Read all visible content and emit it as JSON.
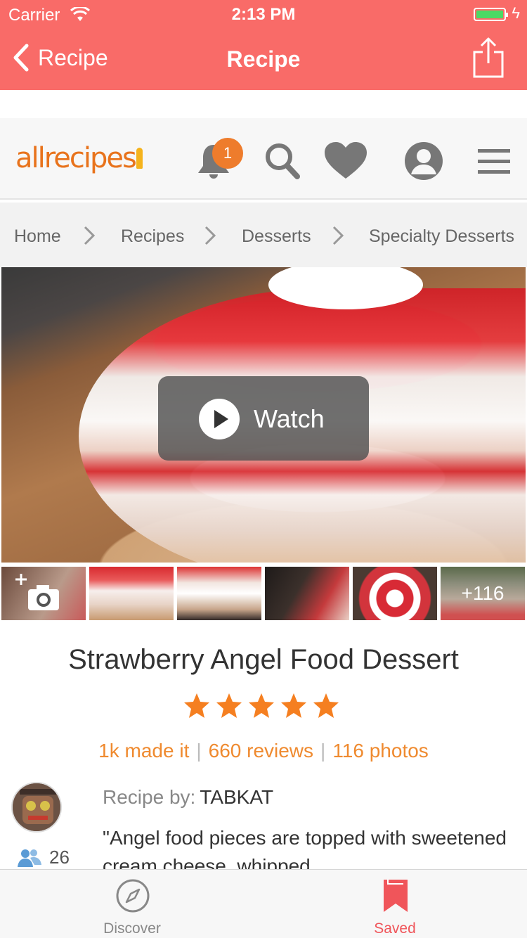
{
  "status_bar": {
    "carrier": "Carrier",
    "time": "2:13 PM"
  },
  "nav": {
    "back_label": "Recipe",
    "title": "Recipe"
  },
  "header": {
    "logo_text": "allrecipes",
    "notification_count": "1"
  },
  "breadcrumb": [
    "Home",
    "Recipes",
    "Desserts",
    "Specialty Desserts"
  ],
  "hero": {
    "watch_label": "Watch"
  },
  "thumbnails": {
    "more_label": "+116"
  },
  "recipe": {
    "title": "Strawberry Angel Food Dessert",
    "rating": 5,
    "made_it": "1k made it",
    "reviews": "660 reviews",
    "photos": "116 photos",
    "recipe_by_label": "Recipe by:",
    "author": "TABKAT",
    "followers": "26",
    "description": "\"Angel food pieces are topped with sweetened cream cheese, whipped"
  },
  "tabbar": {
    "discover_label": "Discover",
    "saved_label": "Saved"
  },
  "colors": {
    "brand": "#f96b68",
    "accent": "#ef8a2f",
    "star": "#f57f20",
    "logo": "#e8731c"
  }
}
